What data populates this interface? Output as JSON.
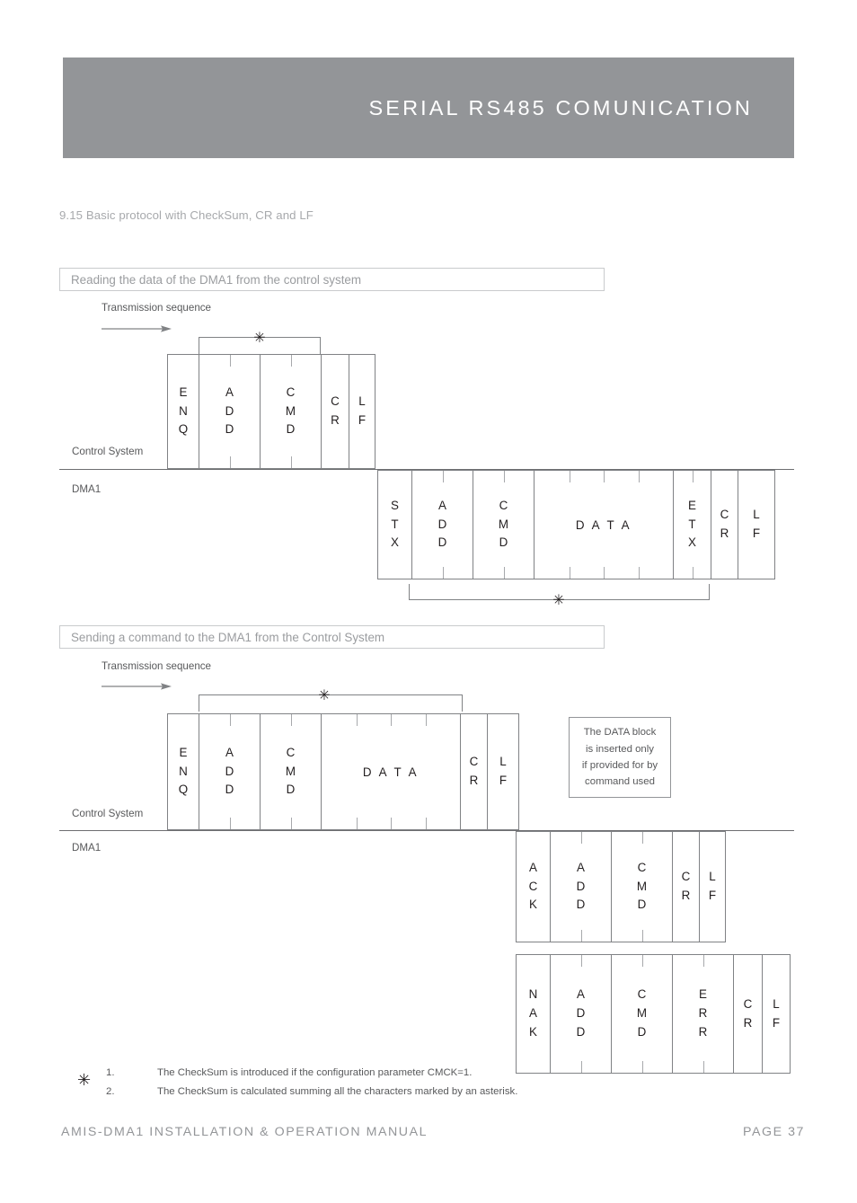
{
  "header": {
    "title": "SERIAL RS485 COMUNICATION",
    "background_color": "#939598"
  },
  "subtitle": "9.15 Basic protocol with CheckSum, CR and LF",
  "diagram1": {
    "section_title": "Reading the data of the DMA1 from the control system",
    "transmission_label": "Transmission sequence",
    "row_labels": {
      "control_system": "Control System",
      "dma1": "DMA1"
    },
    "control_system_frame": [
      {
        "label": "ENQ",
        "chars": [
          "E",
          "N",
          "Q"
        ],
        "ticks": 0
      },
      {
        "label": "ADD",
        "chars": [
          "A",
          "D",
          "D"
        ],
        "ticks": 1
      },
      {
        "label": "CMD",
        "chars": [
          "C",
          "M",
          "D"
        ],
        "ticks": 1
      },
      {
        "label": "CR",
        "chars": [
          "C",
          "R"
        ],
        "ticks": 0
      },
      {
        "label": "LF",
        "chars": [
          "L",
          "F"
        ],
        "ticks": 0
      }
    ],
    "dma1_frame": [
      {
        "label": "STX",
        "chars": [
          "S",
          "T",
          "X"
        ],
        "ticks": 0
      },
      {
        "label": "ADD",
        "chars": [
          "A",
          "D",
          "D"
        ],
        "ticks": 1
      },
      {
        "label": "CMD",
        "chars": [
          "C",
          "M",
          "D"
        ],
        "ticks": 1
      },
      {
        "label": "DATA",
        "wide": "D A T A",
        "ticks": 3
      },
      {
        "label": "ETX",
        "chars": [
          "E",
          "T",
          "X"
        ],
        "ticks": 1
      },
      {
        "label": "CR",
        "chars": [
          "C",
          "R"
        ],
        "ticks": 0
      },
      {
        "label": "LF",
        "chars": [
          "L",
          "F"
        ],
        "ticks": 0
      }
    ],
    "checksum_marker": "✳"
  },
  "diagram2": {
    "section_title": "Sending a command to the DMA1 from the Control System",
    "transmission_label": "Transmission sequence",
    "row_labels": {
      "control_system": "Control System",
      "dma1": "DMA1"
    },
    "control_system_frame": [
      {
        "label": "ENQ",
        "chars": [
          "E",
          "N",
          "Q"
        ],
        "ticks": 0
      },
      {
        "label": "ADD",
        "chars": [
          "A",
          "D",
          "D"
        ],
        "ticks": 1
      },
      {
        "label": "CMD",
        "chars": [
          "C",
          "M",
          "D"
        ],
        "ticks": 1
      },
      {
        "label": "DATA",
        "wide": "D A T A",
        "ticks": 3
      },
      {
        "label": "CR",
        "chars": [
          "C",
          "R"
        ],
        "ticks": 0
      },
      {
        "label": "LF",
        "chars": [
          "L",
          "F"
        ],
        "ticks": 0
      }
    ],
    "ack_frame": [
      {
        "label": "ACK",
        "chars": [
          "A",
          "C",
          "K"
        ],
        "ticks": 0
      },
      {
        "label": "ADD",
        "chars": [
          "A",
          "D",
          "D"
        ],
        "ticks": 1
      },
      {
        "label": "CMD",
        "chars": [
          "C",
          "M",
          "D"
        ],
        "ticks": 1
      },
      {
        "label": "CR",
        "chars": [
          "C",
          "R"
        ],
        "ticks": 0
      },
      {
        "label": "LF",
        "chars": [
          "L",
          "F"
        ],
        "ticks": 0
      }
    ],
    "nak_frame": [
      {
        "label": "NAK",
        "chars": [
          "N",
          "A",
          "K"
        ],
        "ticks": 0
      },
      {
        "label": "ADD",
        "chars": [
          "A",
          "D",
          "D"
        ],
        "ticks": 1
      },
      {
        "label": "CMD",
        "chars": [
          "C",
          "M",
          "D"
        ],
        "ticks": 1
      },
      {
        "label": "ERR",
        "chars": [
          "E",
          "R",
          "R"
        ],
        "ticks": 1
      },
      {
        "label": "CR",
        "chars": [
          "C",
          "R"
        ],
        "ticks": 0
      },
      {
        "label": "LF",
        "chars": [
          "L",
          "F"
        ],
        "ticks": 0
      }
    ],
    "note_box": [
      "The DATA block",
      "is inserted only",
      "if provided for by",
      "command used"
    ],
    "checksum_marker": "✳"
  },
  "footnotes": {
    "marker": "✳",
    "items": [
      {
        "num": "1.",
        "text": "The CheckSum is introduced if the configuration parameter CMCK=1."
      },
      {
        "num": "2.",
        "text": "The CheckSum is calculated summing all the characters marked by an asterisk."
      }
    ]
  },
  "footer": {
    "left": "AMIS-DMA1 INSTALLATION & OPERATION MANUAL",
    "right": "PAGE 37"
  }
}
